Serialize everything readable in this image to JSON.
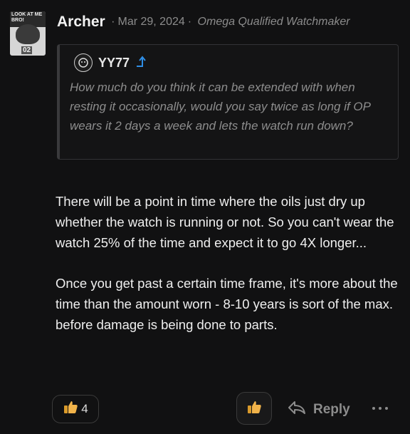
{
  "post": {
    "author": "Archer",
    "date": "Mar 29, 2024",
    "user_title": "Omega Qualified Watchmaker",
    "avatar_caption": "LOOK AT ME BRO!",
    "avatar_number": "02"
  },
  "quote": {
    "user": "YY77",
    "text": "How much do you think it can be extended with when resting it occasionally, would you say twice as long if OP wears it 2 days a week and lets the watch run down?"
  },
  "body": {
    "paragraph1": "There will be a point in time where the oils just dry up whether the watch is running or not. So you can't wear the watch 25% of the time and expect it to go 4X longer...",
    "paragraph2": "Once you get past a certain time frame, it's more about the time than the amount worn - 8-10 years is sort of the max. before damage is being done to parts."
  },
  "actions": {
    "like_count": "4",
    "reply_label": "Reply",
    "icons": {
      "like": "thumbs-up-icon",
      "react": "thumbs-up-icon",
      "reply": "reply-arrow-icon",
      "more": "more-dots-icon",
      "jump": "arrow-up-icon"
    }
  },
  "colors": {
    "background": "#111112",
    "muted": "#8c8c8c",
    "link_accent": "#2f8de4",
    "thumb": "#f1b34a"
  }
}
